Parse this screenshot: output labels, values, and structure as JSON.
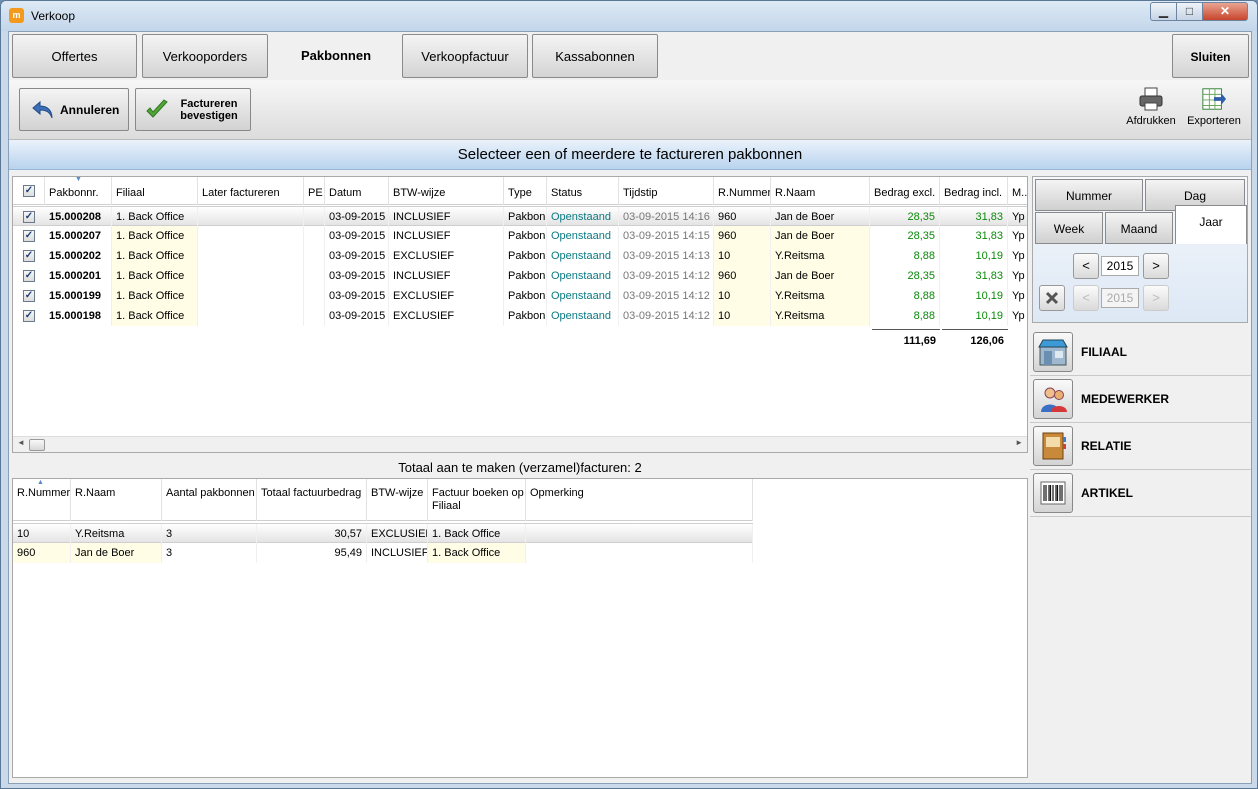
{
  "window": {
    "title": "Verkoop",
    "app_icon": "m"
  },
  "tabs": [
    "Offertes",
    "Verkooporders",
    "Pakbonnen",
    "Verkoopfactuur",
    "Kassabonnen"
  ],
  "active_tab": "Pakbonnen",
  "close_label": "Sluiten",
  "toolbar": {
    "cancel_label": "Annuleren",
    "confirm_label": "Factureren bevestigen",
    "print_label": "Afdrukken",
    "export_label": "Exporteren"
  },
  "banner": "Selecteer een of meerdere te factureren pakbonnen",
  "grid1": {
    "columns": [
      "Pakbonnr.",
      "Filiaal",
      "Later factureren",
      "PE",
      "Datum",
      "BTW-wijze",
      "Type",
      "Status",
      "Tijdstip",
      "R.Nummer",
      "R.Naam",
      "Bedrag excl.",
      "Bedrag incl.",
      "M.."
    ],
    "rows": [
      {
        "nr": "15.000208",
        "filiaal": "1. Back Office",
        "later": "",
        "pe": "",
        "datum": "03-09-2015",
        "btw": "INCLUSIEF",
        "type": "Pakbon",
        "status": "Openstaand",
        "tijd": "03-09-2015 14:16",
        "rnr": "960",
        "rnaam": "Jan de Boer",
        "excl": "28,35",
        "incl": "31,83",
        "m": "Yp"
      },
      {
        "nr": "15.000207",
        "filiaal": "1. Back Office",
        "later": "",
        "pe": "",
        "datum": "03-09-2015",
        "btw": "INCLUSIEF",
        "type": "Pakbon",
        "status": "Openstaand",
        "tijd": "03-09-2015 14:15",
        "rnr": "960",
        "rnaam": "Jan de Boer",
        "excl": "28,35",
        "incl": "31,83",
        "m": "Yp"
      },
      {
        "nr": "15.000202",
        "filiaal": "1. Back Office",
        "later": "",
        "pe": "",
        "datum": "03-09-2015",
        "btw": "EXCLUSIEF",
        "type": "Pakbon",
        "status": "Openstaand",
        "tijd": "03-09-2015 14:13",
        "rnr": "10",
        "rnaam": "Y.Reitsma",
        "excl": "8,88",
        "incl": "10,19",
        "m": "Yp"
      },
      {
        "nr": "15.000201",
        "filiaal": "1. Back Office",
        "later": "",
        "pe": "",
        "datum": "03-09-2015",
        "btw": "INCLUSIEF",
        "type": "Pakbon",
        "status": "Openstaand",
        "tijd": "03-09-2015 14:12",
        "rnr": "960",
        "rnaam": "Jan de Boer",
        "excl": "28,35",
        "incl": "31,83",
        "m": "Yp"
      },
      {
        "nr": "15.000199",
        "filiaal": "1. Back Office",
        "later": "",
        "pe": "",
        "datum": "03-09-2015",
        "btw": "EXCLUSIEF",
        "type": "Pakbon",
        "status": "Openstaand",
        "tijd": "03-09-2015 14:12",
        "rnr": "10",
        "rnaam": "Y.Reitsma",
        "excl": "8,88",
        "incl": "10,19",
        "m": "Yp"
      },
      {
        "nr": "15.000198",
        "filiaal": "1. Back Office",
        "later": "",
        "pe": "",
        "datum": "03-09-2015",
        "btw": "EXCLUSIEF",
        "type": "Pakbon",
        "status": "Openstaand",
        "tijd": "03-09-2015 14:12",
        "rnr": "10",
        "rnaam": "Y.Reitsma",
        "excl": "8,88",
        "incl": "10,19",
        "m": "Yp"
      }
    ],
    "total_excl": "111,69",
    "total_incl": "126,06"
  },
  "summary_title": "Totaal aan te maken (verzamel)facturen: 2",
  "grid2": {
    "columns": [
      "R.Nummer",
      "R.Naam",
      "Aantal pakbonnen",
      "Totaal factuurbedrag",
      "BTW-wijze",
      "Factuur boeken op Filiaal",
      "Opmerking"
    ],
    "rows": [
      {
        "rnr": "10",
        "rnaam": "Y.Reitsma",
        "aantal": "3",
        "totaal": "30,57",
        "btw": "EXCLUSIEF",
        "filiaal": "1. Back Office",
        "opm": ""
      },
      {
        "rnr": "960",
        "rnaam": "Jan de Boer",
        "aantal": "3",
        "totaal": "95,49",
        "btw": "INCLUSIEF",
        "filiaal": "1. Back Office",
        "opm": ""
      }
    ]
  },
  "date_filter": {
    "tabs_top": [
      "Nummer",
      "Dag"
    ],
    "tabs_bottom": [
      "Week",
      "Maand",
      "Jaar"
    ],
    "active": "Jaar",
    "prev": "<",
    "next": ">",
    "year": "2015",
    "year_to": "2015"
  },
  "filters": [
    "FILIAAL",
    "MEDEWERKER",
    "RELATIE",
    "ARTIKEL"
  ],
  "colors": {
    "accent_green": "#0b8a0b",
    "status_teal": "#0a7a82",
    "banner_blue": "#b9d3ee"
  }
}
